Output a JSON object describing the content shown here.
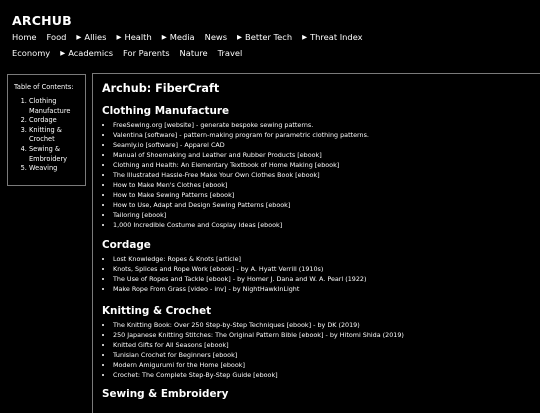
{
  "site": {
    "title": "ARCHUB"
  },
  "nav": {
    "row1": [
      {
        "label": "Home",
        "arrow": false
      },
      {
        "label": "Food",
        "arrow": false
      },
      {
        "label": "Allies",
        "arrow": true
      },
      {
        "label": "Health",
        "arrow": true
      },
      {
        "label": "Media",
        "arrow": true
      },
      {
        "label": "News",
        "arrow": false
      },
      {
        "label": "Better Tech",
        "arrow": true
      },
      {
        "label": "Threat Index",
        "arrow": true
      }
    ],
    "row2": [
      {
        "label": "Economy",
        "arrow": false
      },
      {
        "label": "Academics",
        "arrow": true
      },
      {
        "label": "For Parents",
        "arrow": false
      },
      {
        "label": "Nature",
        "arrow": false
      },
      {
        "label": "Travel",
        "arrow": false
      }
    ],
    "arrow_glyph": "▶"
  },
  "toc": {
    "title": "Table of Contents:",
    "items": [
      "Clothing Manufacture",
      "Cordage",
      "Knitting & Crochet",
      "Sewing & Embroidery",
      "Weaving"
    ]
  },
  "page": {
    "title": "Archub: FiberCraft"
  },
  "sections": [
    {
      "heading": "Clothing Manufacture",
      "items": [
        "FreeSewing.org [website] - generate bespoke sewing patterns.",
        "Valentina [software] - pattern-making program for parametric clothing patterns.",
        "Seamly.io [software] - Apparel CAD",
        "Manual of Shoemaking and Leather and Rubber Products [ebook]",
        "Clothing and Health: An Elementary Textbook of Home Making [ebook]",
        "The Illustrated Hassle-Free Make Your Own Clothes Book [ebook]",
        "How to Make Men's Clothes [ebook]",
        "How to Make Sewing Patterns [ebook]",
        "How to Use, Adapt and Design Sewing Patterns [ebook]",
        "Tailoring [ebook]",
        "1,000 Incredible Costume and Cosplay Ideas [ebook]"
      ]
    },
    {
      "heading": "Cordage",
      "items": [
        "Lost Knowledge: Ropes & Knots [article]",
        "Knots, Splices and Rope Work [ebook] - by A. Hyatt Verrill (1910s)",
        "The Use of Ropes and Tackle [ebook] - by Homer J. Dana and W. A. Pearl (1922)",
        "Make Rope From Grass [video - inv] - by NightHawkInLight"
      ]
    },
    {
      "heading": "Knitting & Crochet",
      "items": [
        "The Knitting Book: Over 250 Step-by-Step Techniques [ebook] - by DK (2019)",
        "250 Japanese Knitting Stitches: The Original Pattern Bible [ebook] - by Hitomi Shida (2019)",
        "Knitted Gifts for All Seasons [ebook]",
        "Tunisian Crochet for Beginners [ebook]",
        "Modern Amigurumi for the Home [ebook]",
        "Crochet: The Complete Step-By-Step Guide [ebook]"
      ]
    },
    {
      "heading": "Sewing & Embroidery",
      "items": []
    }
  ],
  "colors": {
    "background": "#000000",
    "text": "#ffffff",
    "border": "#7a7a7a"
  }
}
